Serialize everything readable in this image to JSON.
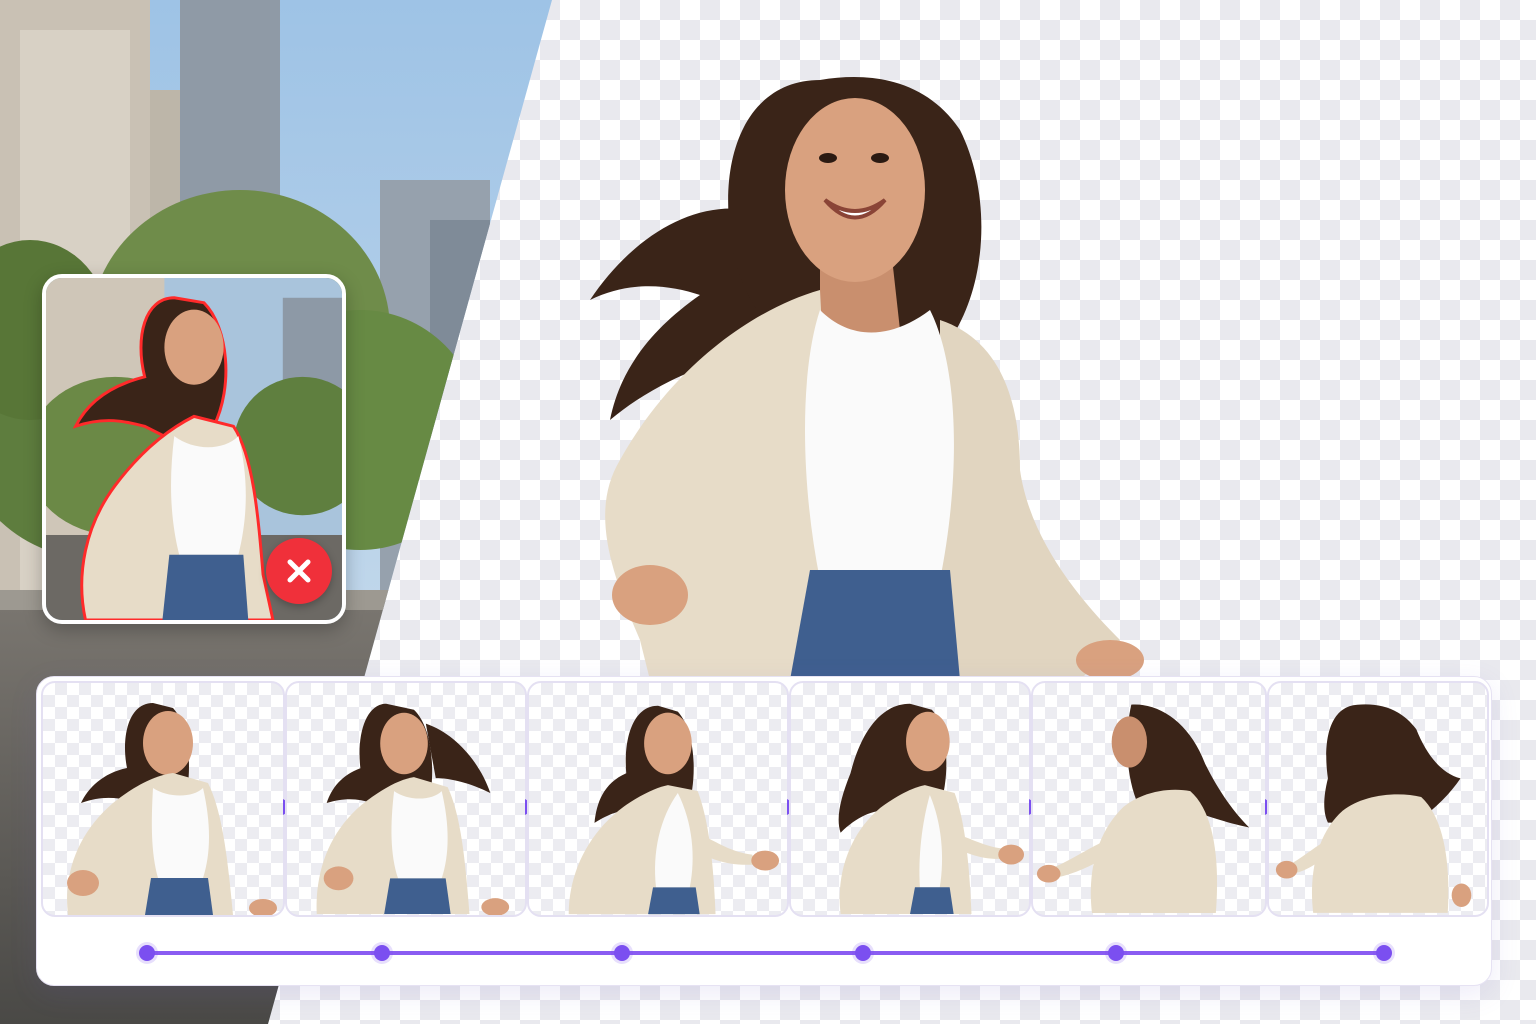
{
  "colors": {
    "accent": "#7b4ff0",
    "reject": "#f0303a",
    "checker": "#e9e9ee",
    "panel_border": "#e6e2f3"
  },
  "icons": {
    "reject": "close-icon",
    "frame_step": "play-triangle-icon",
    "keyframe": "circle-dot-icon"
  },
  "timeline": {
    "frame_count": 6,
    "keyframe_count": 6,
    "frames": [
      {
        "pose": "front-smile"
      },
      {
        "pose": "three-quarter"
      },
      {
        "pose": "turning"
      },
      {
        "pose": "over-shoulder"
      },
      {
        "pose": "back-left"
      },
      {
        "pose": "back"
      }
    ]
  }
}
